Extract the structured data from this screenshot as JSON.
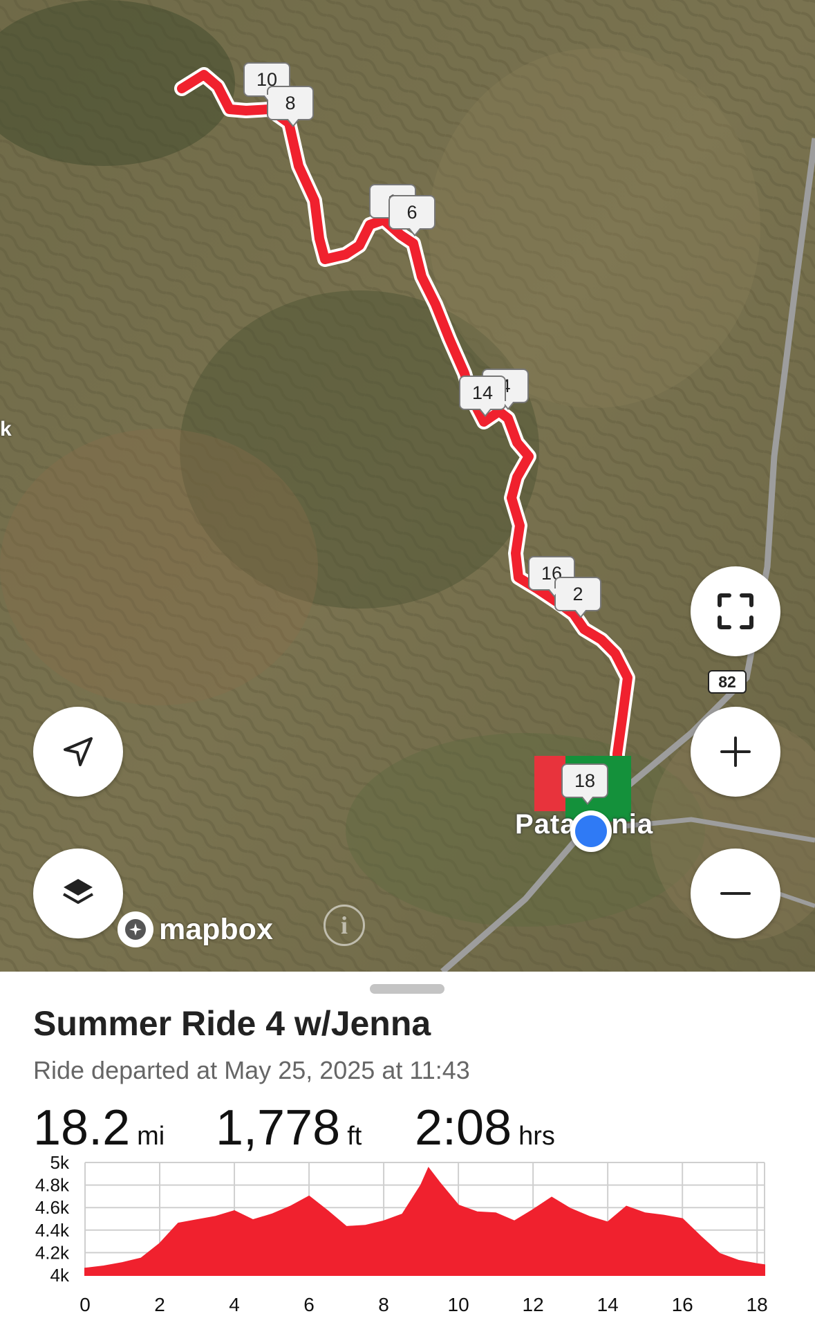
{
  "map": {
    "town_label": "Patagonia",
    "edge_label": "k",
    "highway_shield": "82",
    "attribution_logo": "mapbox",
    "info_icon_glyph": "i",
    "route_color": "#f0212e",
    "mile_markers": [
      "10",
      "8",
      "1",
      "6",
      "14",
      "4",
      "16",
      "2",
      "18"
    ],
    "icons": {
      "locate": "navigation-arrow-icon",
      "layers": "layers-icon",
      "fullscreen": "fullscreen-icon",
      "zoom_in": "plus-icon",
      "zoom_out": "minus-icon",
      "current_location": "blue-location-dot-icon"
    }
  },
  "ride": {
    "title": "Summer Ride 4 w/Jenna",
    "subtitle": "Ride departed at May 25, 2025 at 11:43",
    "stats": [
      {
        "value": "18.2",
        "unit": "mi"
      },
      {
        "value": "1,778",
        "unit": "ft"
      },
      {
        "value": "2:08",
        "unit": "hrs"
      }
    ]
  },
  "chart_data": {
    "type": "area",
    "xlabel": "",
    "ylabel": "",
    "xlim": [
      0,
      18.2
    ],
    "ylim": [
      4000,
      5000
    ],
    "x_ticks": [
      "0",
      "2",
      "4",
      "6",
      "8",
      "10",
      "12",
      "14",
      "16",
      "18"
    ],
    "y_ticks": [
      "4k",
      "4.2k",
      "4.4k",
      "4.6k",
      "4.8k",
      "5k"
    ],
    "grid": true,
    "fill_color": "#f0212e",
    "series": [
      {
        "x": [
          0,
          0.5,
          1,
          1.5,
          2,
          2.5,
          3,
          3.5,
          4,
          4.5,
          5,
          5.5,
          6,
          6.5,
          7,
          7.5,
          8,
          8.5,
          9,
          9.2,
          9.5,
          10,
          10.5,
          11,
          11.5,
          12,
          12.5,
          13,
          13.5,
          14,
          14.5,
          15,
          15.5,
          16,
          16.5,
          17,
          17.5,
          18,
          18.2
        ],
        "y": [
          4060,
          4080,
          4110,
          4150,
          4280,
          4460,
          4490,
          4520,
          4570,
          4490,
          4540,
          4610,
          4700,
          4570,
          4430,
          4440,
          4480,
          4540,
          4800,
          4950,
          4820,
          4620,
          4560,
          4550,
          4480,
          4580,
          4690,
          4590,
          4520,
          4470,
          4610,
          4550,
          4530,
          4500,
          4340,
          4190,
          4130,
          4100,
          4090
        ]
      }
    ]
  }
}
